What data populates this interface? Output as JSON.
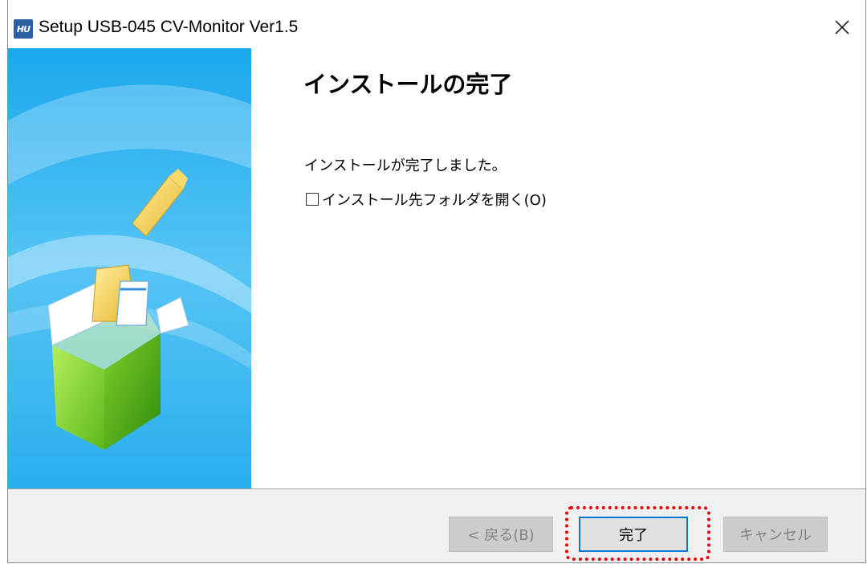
{
  "window": {
    "title": "Setup USB-045 CV-Monitor Ver1.5",
    "app_icon_text": "HU",
    "close_label": "✕"
  },
  "content": {
    "heading": "インストールの完了",
    "message": "インストールが完了しました。",
    "open_folder_checkbox": {
      "label": "インストール先フォルダを開く(O)",
      "checked": false
    }
  },
  "footer": {
    "back_label": "< 戻る(B)",
    "finish_label": "完了",
    "cancel_label": "キャンセル"
  },
  "colors": {
    "sidebar_blue": "#3fb4ee",
    "focus_border": "#0078d7",
    "highlight_annotation": "#e60000"
  }
}
